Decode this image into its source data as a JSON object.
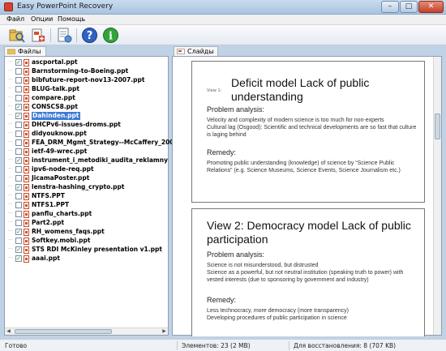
{
  "window": {
    "title": "Easy PowerPoint Recovery"
  },
  "menu": [
    "Файл",
    "Опции",
    "Помощь"
  ],
  "toolbar": {
    "icons": [
      "open-folder-icon",
      "add-file-icon",
      "recovery-wizard-icon",
      "help-icon",
      "info-icon"
    ]
  },
  "left_tab": {
    "label": "Файлы"
  },
  "right_tab": {
    "label": "Слайды"
  },
  "files": [
    {
      "name": "ascportal.ppt",
      "checked": true
    },
    {
      "name": "Barnstorming-to-Boeing.ppt",
      "checked": false
    },
    {
      "name": "bibfuture-report-nov13-2007.ppt",
      "checked": false
    },
    {
      "name": "BLUG-talk.ppt",
      "checked": false
    },
    {
      "name": "compare.ppt",
      "checked": false
    },
    {
      "name": "CONSCS8.ppt",
      "checked": true
    },
    {
      "name": "Dahinden.ppt",
      "checked": true,
      "selected": true
    },
    {
      "name": "DHCPv6-issues-droms.ppt",
      "checked": false
    },
    {
      "name": "didyouknow.ppt",
      "checked": false
    },
    {
      "name": "FEA_DRM_Mgmt_Strategy--McCaffery_200",
      "checked": false
    },
    {
      "name": "ietf-49-wrec.ppt",
      "checked": false
    },
    {
      "name": "instrument_i_metodiki_audita_reklamny",
      "checked": true
    },
    {
      "name": "ipv6-node-req.ppt",
      "checked": false
    },
    {
      "name": "JicamaPoster.ppt",
      "checked": false
    },
    {
      "name": "lenstra-hashing_crypto.ppt",
      "checked": true
    },
    {
      "name": "NTFS.PPT",
      "checked": false
    },
    {
      "name": "NTFS1.PPT",
      "checked": false
    },
    {
      "name": "panflu_charts.ppt",
      "checked": false
    },
    {
      "name": "Part2.ppt",
      "checked": false
    },
    {
      "name": "RH_womens_faqs.ppt",
      "checked": true
    },
    {
      "name": "Softkey.mobi.ppt",
      "checked": false
    },
    {
      "name": "STS RDI McKinley presentation v1.ppt",
      "checked": true
    },
    {
      "name": "aaai.ppt",
      "checked": true
    }
  ],
  "slides": [
    {
      "small_label": "View 1:",
      "title": "Deficit model Lack of public understanding",
      "heading1": "Problem analysis:",
      "body1": "Velocity and complexity of modern science is too much for non-experts\nCultural lag (Osgood): Scientific and technical developments are so fast that culture is laging behind",
      "heading2": "Remedy:",
      "body2": "Promoting public understanding (knowledge) of science by “Science Public Relations” (e.g. Science Museums, Science Events, Science Journalism etc.)"
    },
    {
      "title": "View 2: Democracy model Lack of public participation",
      "heading1": "Problem analysis:",
      "body1": "Science is not misunderstood, but distrusted\nScience as a powerful, but not neutral institution (speaking truth to power) with vested interests (due to sponsoring by government and industry)",
      "heading2": "Remedy:",
      "body2": "Less technocracy, more democracy (more transparency)\nDeveloping procedures of public participation in science"
    }
  ],
  "status": {
    "ready": "Готово",
    "items": "Элементов: 23 (2 MB)",
    "to_recover": "Для восстановления: 8 (707 KB)"
  }
}
